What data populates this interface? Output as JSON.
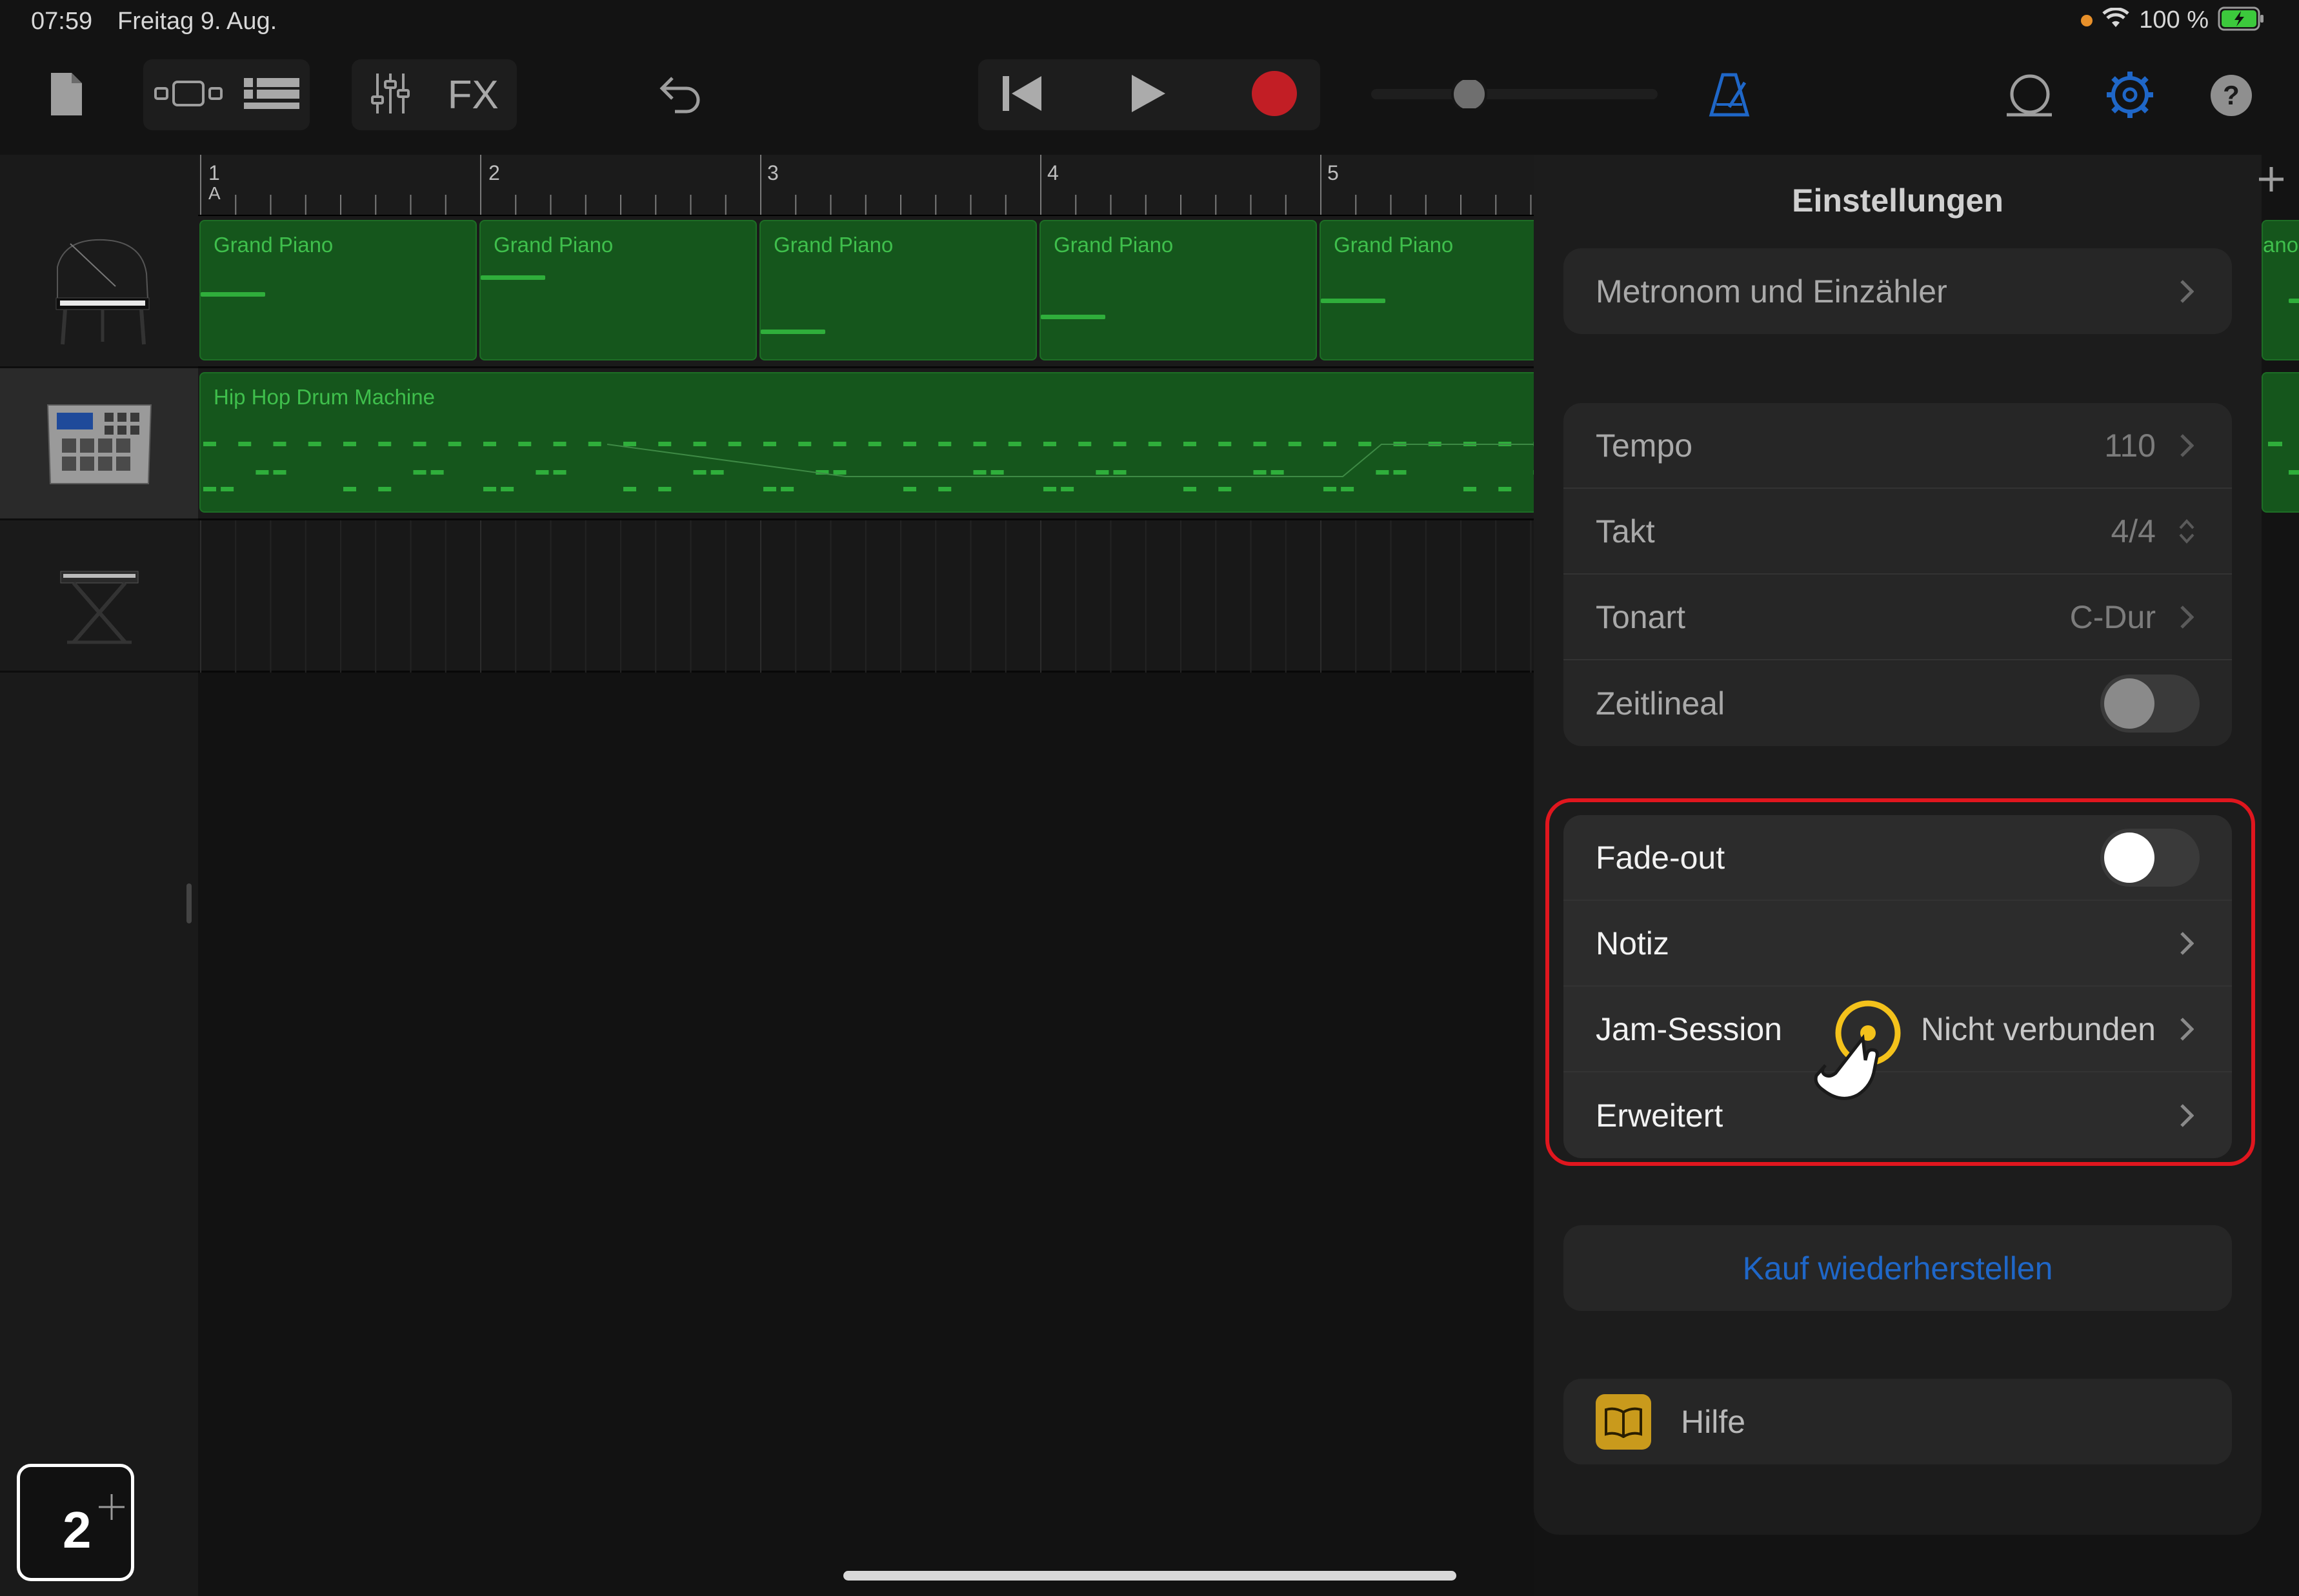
{
  "status_bar": {
    "time": "07:59",
    "date": "Freitag 9. Aug.",
    "battery": "100 %"
  },
  "toolbar": {
    "fx_label": "FX"
  },
  "tracks": [
    {
      "instrument": "Grand Piano",
      "icon": "grand-piano-icon"
    },
    {
      "instrument": "Hip Hop Drum Machine",
      "icon": "drum-machine-icon"
    },
    {
      "instrument": "",
      "icon": "keyboard-stand-icon"
    }
  ],
  "ruler": {
    "bars": [
      "1",
      "2",
      "3",
      "4",
      "5"
    ],
    "marker": "A"
  },
  "regions": {
    "piano": [
      "Grand Piano",
      "Grand Piano",
      "Grand Piano",
      "Grand Piano",
      "Grand Piano"
    ],
    "piano_partial": "ano",
    "drums": "Hip Hop Drum Machine"
  },
  "settings": {
    "title": "Einstellungen",
    "metronome": "Metronom und Einzähler",
    "tempo_label": "Tempo",
    "tempo_value": "110",
    "takt_label": "Takt",
    "takt_value": "4/4",
    "tonart_label": "Tonart",
    "tonart_value": "C-Dur",
    "zeitlineal_label": "Zeitlineal",
    "zeitlineal_on": false,
    "fadeout_label": "Fade-out",
    "fadeout_on": false,
    "notiz_label": "Notiz",
    "jam_label": "Jam-Session",
    "jam_value": "Nicht verbunden",
    "erweitert_label": "Erweitert",
    "restore_label": "Kauf wiederherstellen",
    "help_label": "Hilfe"
  },
  "tutorial": {
    "step_number": "2"
  },
  "colors": {
    "accent_blue": "#1f67c8",
    "record_red": "#c21e25",
    "region_green": "#15561c",
    "highlight_red": "#e0161e",
    "pointer_yellow": "#f4c21b"
  }
}
